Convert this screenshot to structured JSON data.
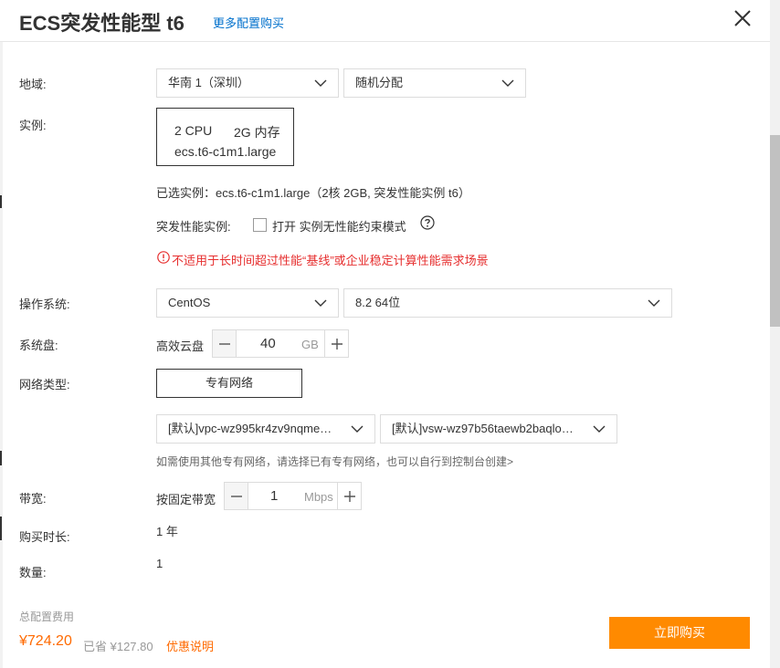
{
  "header": {
    "title": "ECS突发性能型 t6",
    "more_link": "更多配置购买"
  },
  "region": {
    "label": "地域:",
    "region_value": "华南 1（深圳）",
    "zone_value": "随机分配"
  },
  "instance": {
    "label": "实例:",
    "cpu": "2 CPU",
    "memory": "2G 内存",
    "spec": "ecs.t6-c1m1.large",
    "selected_text": "已选实例：ecs.t6-c1m1.large（2核 2GB, 突发性能实例 t6）",
    "burst_label": "突发性能实例:",
    "unlimited_mode_label": "打开 实例无性能约束模式",
    "unlimited_mode_checked": false,
    "warning": "不适用于长时间超过性能“基线”或企业稳定计算性能需求场景"
  },
  "os": {
    "label": "操作系统:",
    "os_value": "CentOS",
    "version_value": "8.2 64位"
  },
  "disk": {
    "label": "系统盘:",
    "type": "高效云盘",
    "size": "40",
    "unit": "GB"
  },
  "network": {
    "label": "网络类型:",
    "type_button": "专有网络",
    "vpc_value": "[默认]vpc-wz995kr4zv9nqme…",
    "vswitch_value": "[默认]vsw-wz97b56taewb2baqlo…",
    "hint": "如需使用其他专有网络，请选择已有专有网络，也可以自行到控制台创建>"
  },
  "bandwidth": {
    "label": "带宽:",
    "mode": "按固定带宽",
    "value": "1",
    "unit": "Mbps"
  },
  "duration": {
    "label": "购买时长:",
    "value": "1 年"
  },
  "quantity": {
    "label": "数量:",
    "value": "1"
  },
  "footer": {
    "total_label": "总配置费用",
    "price": "¥724.20",
    "saved": "已省 ¥127.80",
    "promo_link": "优惠说明",
    "buy_button": "立即购买"
  },
  "colors": {
    "accent": "#ff8a00",
    "price": "#ff6a00",
    "link": "#0070cc",
    "warning": "#e62e2e"
  },
  "icons": {
    "close": "close-icon",
    "dropdown": "chevron-down-icon",
    "help": "question-circle-icon",
    "warning": "exclamation-circle-icon",
    "minus": "minus-icon",
    "plus": "plus-icon"
  }
}
